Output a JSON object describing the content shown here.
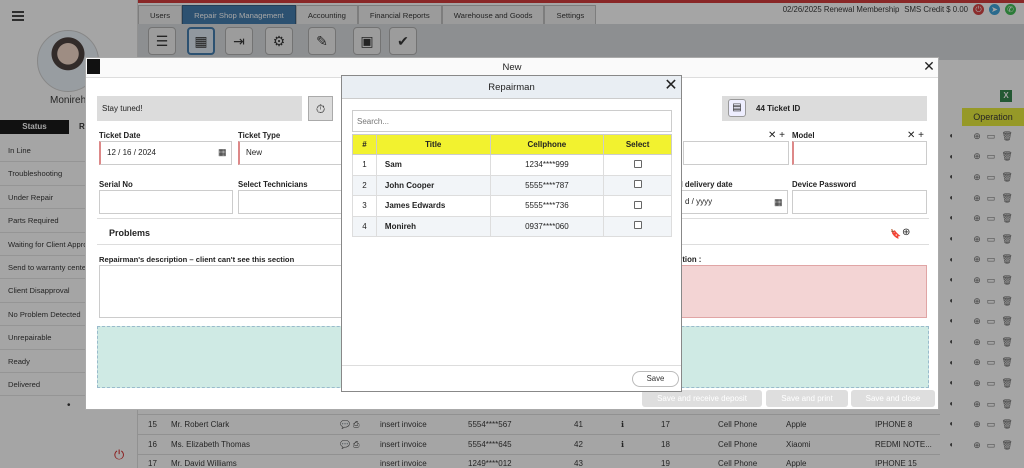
{
  "topnav": {
    "tabs": [
      "Users",
      "Repair Shop Management",
      "Accounting",
      "Financial Reports",
      "Warehouse and Goods",
      "Settings"
    ],
    "renewal": "02/26/2025 Renewal Membership",
    "sms": "SMS Credit $ 0.00"
  },
  "sidebar": {
    "user_name": "Monireh",
    "status_tab": "Status",
    "status_tab_alt": "R",
    "statuses": [
      "In Line",
      "Troubleshooting",
      "Under Repair",
      "Parts Required",
      "Waiting for Client Approval",
      "Send to warranty center",
      "Client Disapproval",
      "No Problem Detected",
      "Unrepairable",
      "Ready",
      "Delivered"
    ]
  },
  "operation": {
    "header": "Operation"
  },
  "background_rows": [
    {
      "id": "15",
      "name": "Mr. Robert Clark",
      "invoice": "insert invoice",
      "phone": "5554****567",
      "num1": "41",
      "num2": "17",
      "type": "Cell Phone",
      "brand": "Apple",
      "model": "IPHONE 8"
    },
    {
      "id": "16",
      "name": "Ms. Elizabeth Thomas",
      "invoice": "insert invoice",
      "phone": "5554****645",
      "num1": "42",
      "num2": "18",
      "type": "Cell Phone",
      "brand": "Xiaomi",
      "model": "REDMI NOTE..."
    },
    {
      "id": "17",
      "name": "Mr. David Williams",
      "invoice": "insert invoice",
      "phone": "1249****012",
      "num1": "43",
      "num2": "19",
      "type": "Cell Phone",
      "brand": "Apple",
      "model": "IPHONE 15"
    }
  ],
  "new_modal": {
    "title": "New",
    "stay_tuned": "Stay tuned!",
    "ticket_id": "44 Ticket ID",
    "ticket_date_label": "Ticket Date",
    "ticket_date": "12 / 16 / 2024",
    "ticket_type_label": "Ticket Type",
    "ticket_type": "New",
    "model_label": "Model",
    "serial_label": "Serial No",
    "technicians_label": "Select Technicians",
    "delivery_label": "d delivery date",
    "delivery_value": "d / yyyy",
    "password_label": "Device Password",
    "problems": "Problems",
    "repairman_desc": "Repairman's description – client can't see this section",
    "client_desc": "ction :",
    "btn_deposit": "Save and receive deposit",
    "btn_print": "Save and print",
    "btn_close": "Save and close"
  },
  "repairman_modal": {
    "title": "Repairman",
    "search_placeholder": "Search...",
    "columns": [
      "#",
      "Title",
      "Cellphone",
      "Select"
    ],
    "rows": [
      {
        "num": "1",
        "title": "Sam",
        "phone": "1234****999"
      },
      {
        "num": "2",
        "title": "John Cooper",
        "phone": "5555****787"
      },
      {
        "num": "3",
        "title": "James Edwards",
        "phone": "5555****736"
      },
      {
        "num": "4",
        "title": "Monireh",
        "phone": "0937****060"
      }
    ],
    "save": "Save"
  }
}
